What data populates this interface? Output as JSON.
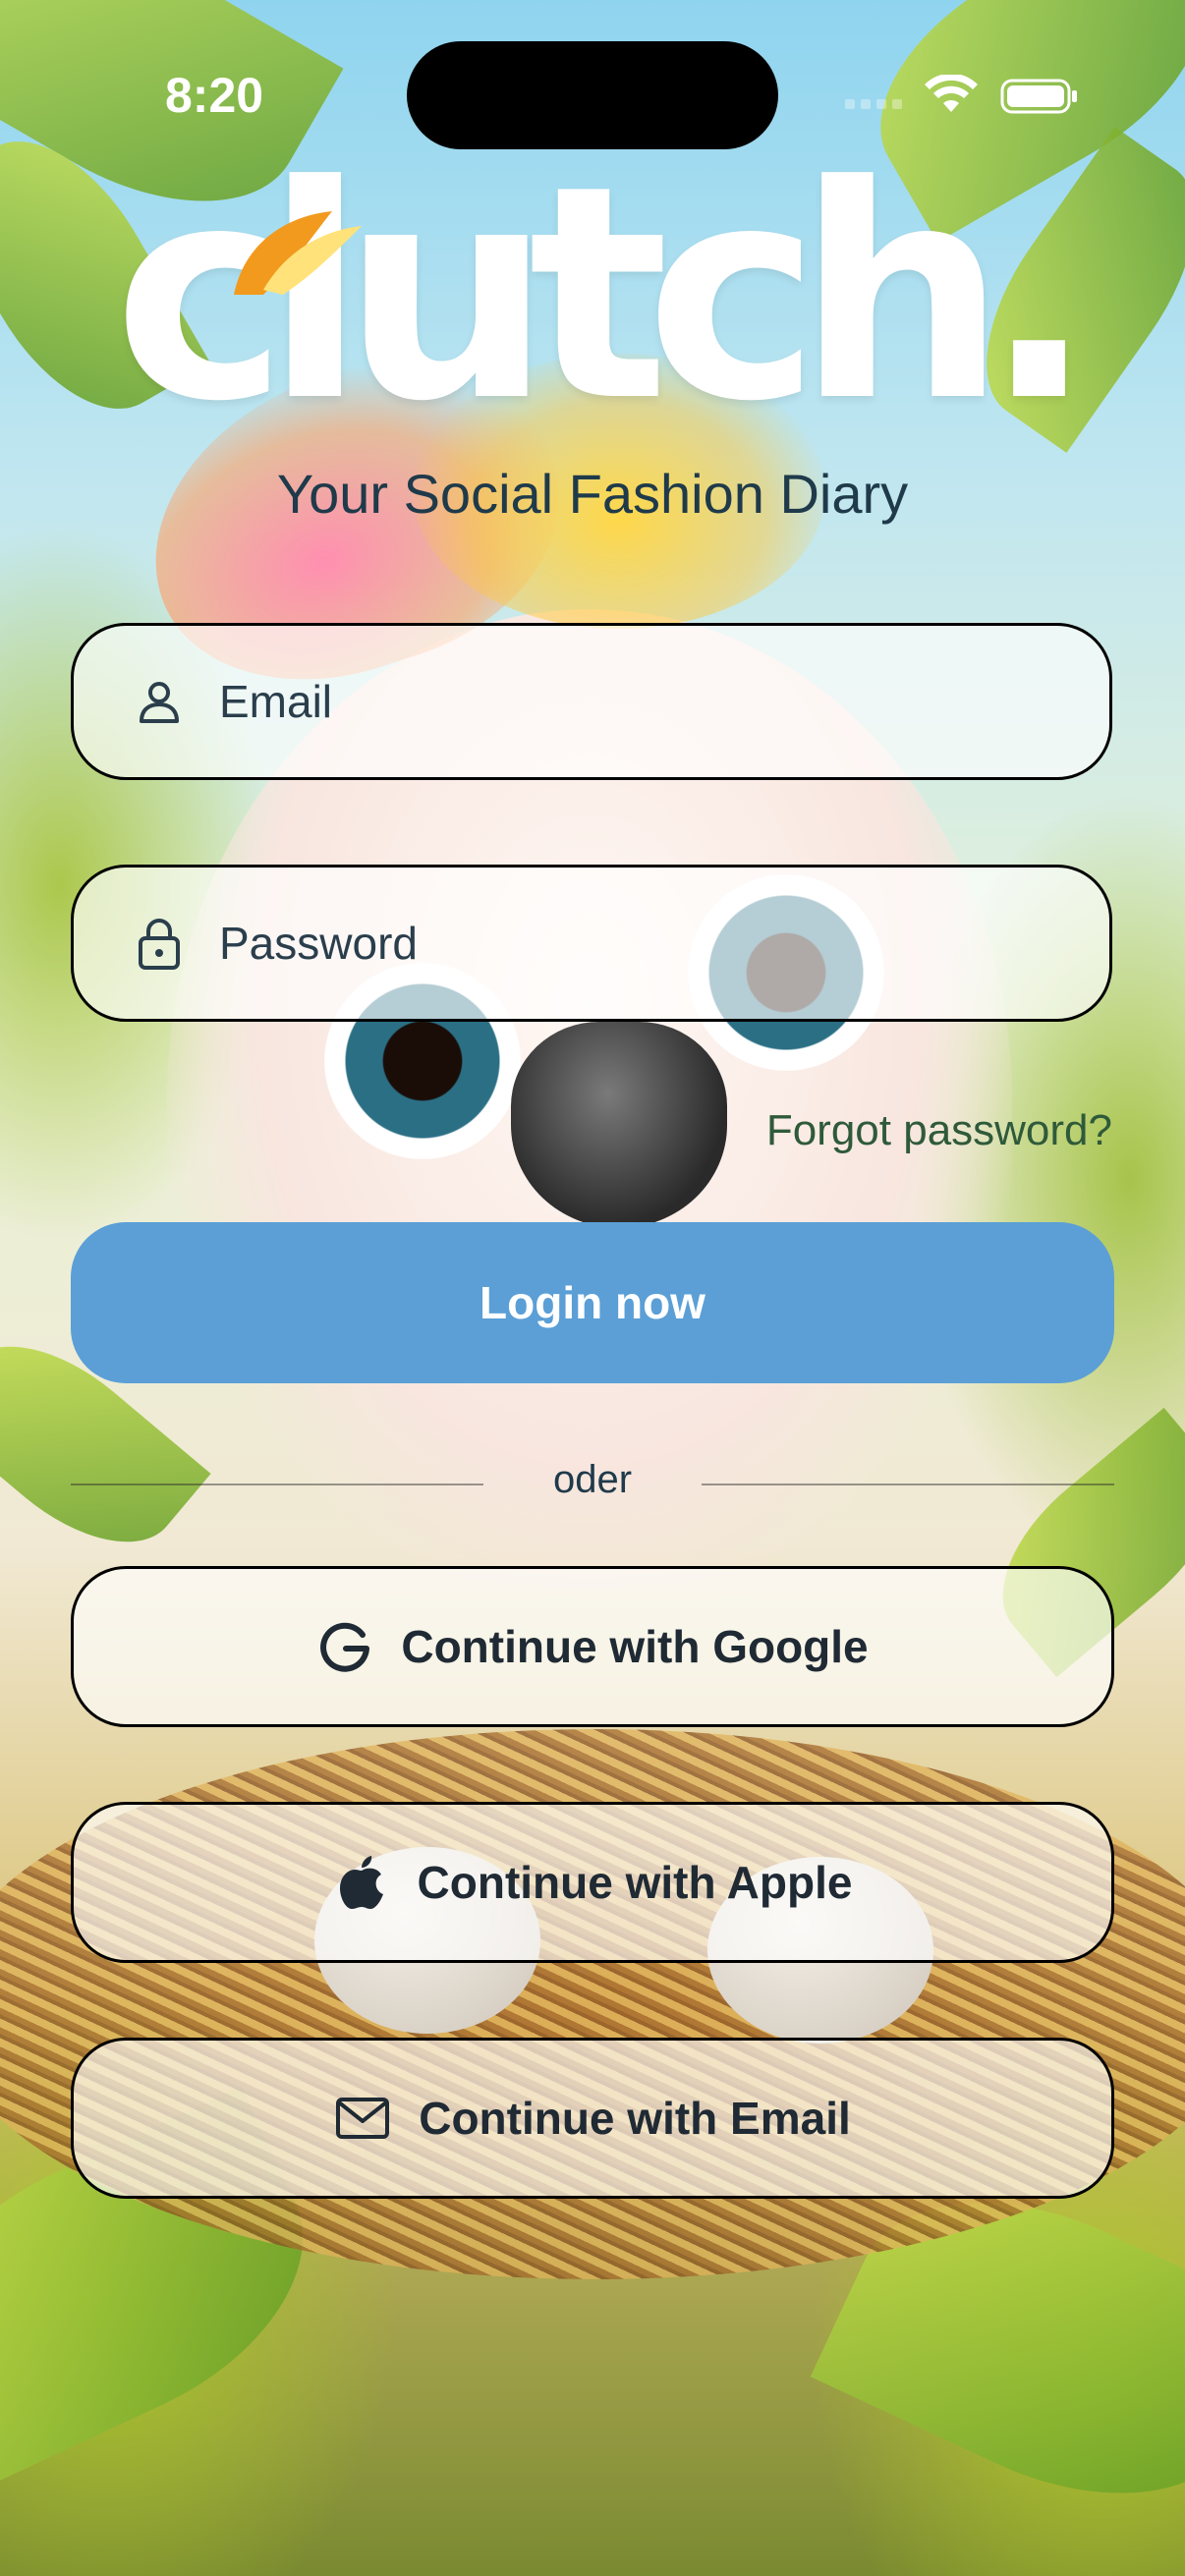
{
  "status_bar": {
    "time": "8:20"
  },
  "brand": {
    "logo_text": "clutch.",
    "tagline": "Your Social Fashion Diary"
  },
  "form": {
    "email_placeholder": "Email",
    "password_placeholder": "Password",
    "forgot_password": "Forgot password?",
    "login_button": "Login now"
  },
  "divider": {
    "text": "oder"
  },
  "social": {
    "google": "Continue with Google",
    "apple": "Continue with Apple",
    "email": "Continue with Email"
  },
  "colors": {
    "primary": "#5b9fd6",
    "link": "#2f5a3a",
    "text": "#1f3a4a"
  },
  "icons": {
    "email_field": "person-icon",
    "password_field": "lock-icon",
    "google": "google-icon",
    "apple": "apple-icon",
    "email": "envelope-icon"
  }
}
